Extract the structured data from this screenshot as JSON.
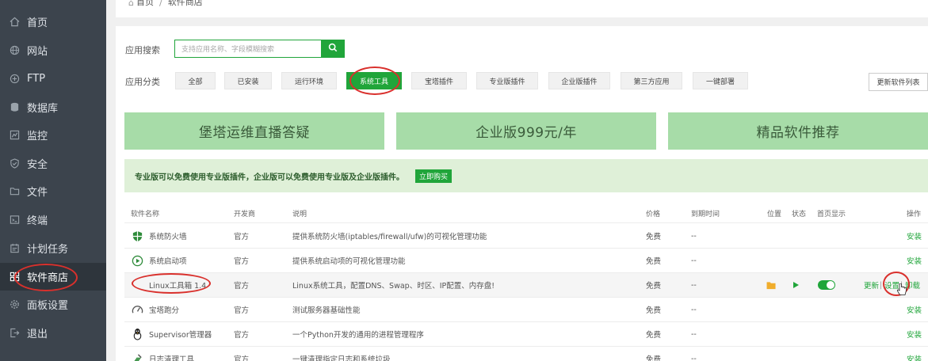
{
  "sidebar": {
    "items": [
      {
        "label": "首页",
        "icon": "home-icon"
      },
      {
        "label": "网站",
        "icon": "globe-icon"
      },
      {
        "label": "FTP",
        "icon": "ftp-icon"
      },
      {
        "label": "数据库",
        "icon": "database-icon"
      },
      {
        "label": "监控",
        "icon": "monitor-icon"
      },
      {
        "label": "安全",
        "icon": "shield-icon"
      },
      {
        "label": "文件",
        "icon": "folder-icon"
      },
      {
        "label": "终端",
        "icon": "terminal-icon"
      },
      {
        "label": "计划任务",
        "icon": "task-icon"
      },
      {
        "label": "软件商店",
        "icon": "grid-icon",
        "active": true
      },
      {
        "label": "面板设置",
        "icon": "gear-icon"
      },
      {
        "label": "退出",
        "icon": "logout-icon"
      }
    ]
  },
  "breadcrumb": {
    "home": "首页",
    "sep": "/",
    "current": "软件商店"
  },
  "search": {
    "label": "应用搜索",
    "placeholder": "支持应用名称、字段模糊搜索"
  },
  "categories": {
    "label": "应用分类",
    "items": [
      "全部",
      "已安装",
      "运行环境",
      "系统工具",
      "宝塔插件",
      "专业版插件",
      "企业版插件",
      "第三方应用",
      "一键部署"
    ],
    "active": "系统工具"
  },
  "update_list_label": "更新软件列表",
  "banners": [
    "堡塔运维直播答疑",
    "企业版999元/年",
    "精品软件推荐"
  ],
  "notice": {
    "text": "专业版可以免费使用专业版插件，企业版可以免费使用专业版及企业版插件。",
    "button": "立即购买"
  },
  "table": {
    "headers": [
      "软件名称",
      "开发商",
      "说明",
      "价格",
      "到期时间",
      "位置",
      "状态",
      "首页显示",
      "操作"
    ],
    "rows": [
      {
        "name": "系统防火墙",
        "dev": "官方",
        "desc": "提供系统防火墙(iptables/firewall/ufw)的可视化管理功能",
        "price": "免费",
        "expire": "--",
        "actions": [
          "安装"
        ],
        "icon": "firewall-icon"
      },
      {
        "name": "系统启动项",
        "dev": "官方",
        "desc": "提供系统启动项的可视化管理功能",
        "price": "免费",
        "expire": "--",
        "actions": [
          "安装"
        ],
        "icon": "startup-icon"
      },
      {
        "name": "Linux工具箱 1.4",
        "dev": "官方",
        "desc": "Linux系统工具，配置DNS、Swap、时区、IP配置、内存盘!",
        "price": "免费",
        "expire": "--",
        "actions": [
          "更新",
          "|",
          "设置",
          "|",
          "卸载"
        ],
        "icon": "toolbox-icon",
        "installed": true
      },
      {
        "name": "宝塔跑分",
        "dev": "官方",
        "desc": "测试服务器基础性能",
        "price": "免费",
        "expire": "--",
        "actions": [
          "安装"
        ],
        "icon": "gauge-icon"
      },
      {
        "name": "Supervisor管理器",
        "dev": "官方",
        "desc": "一个Python开发的通用的进程管理程序",
        "price": "免费",
        "expire": "--",
        "actions": [
          "安装"
        ],
        "icon": "supervisor-icon"
      },
      {
        "name": "日志清理工具",
        "dev": "官方",
        "desc": "一键清理指定日志和系统垃圾",
        "price": "免费",
        "expire": "--",
        "actions": [
          "安装"
        ],
        "icon": "log-clean-icon"
      }
    ]
  },
  "colors": {
    "accent": "#20a53a",
    "sidebar": "#3c444d",
    "highlight_ring": "#d9302c",
    "banner": "#a7dca8"
  }
}
